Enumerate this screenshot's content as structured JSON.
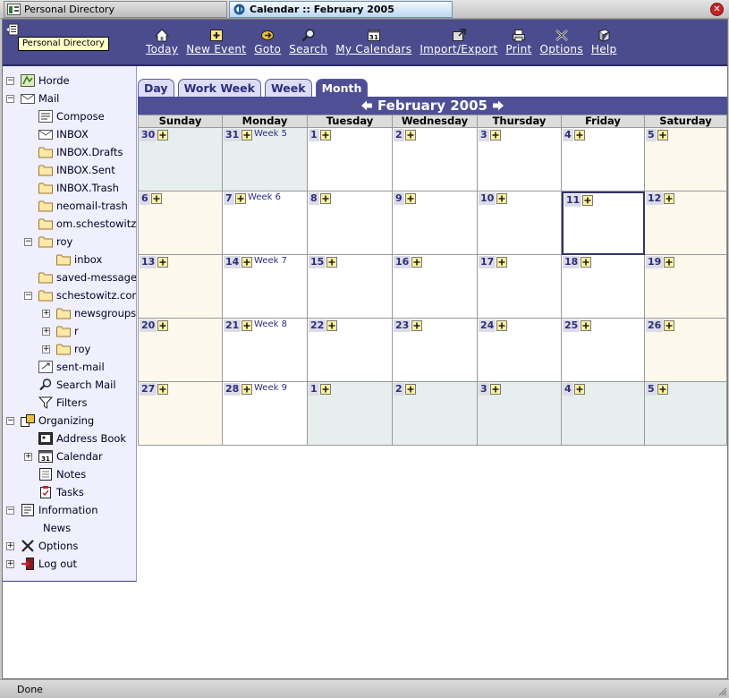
{
  "window_tabs": [
    {
      "label": "Personal Directory",
      "active": false
    },
    {
      "label": "Calendar :: February 2005",
      "active": true
    }
  ],
  "tooltip": "Personal Directory",
  "menu": [
    {
      "label": "Today",
      "icon": "home-icon"
    },
    {
      "label": "New Event",
      "icon": "new-event-icon"
    },
    {
      "label": "Goto",
      "icon": "goto-icon"
    },
    {
      "label": "Search",
      "icon": "search-icon"
    },
    {
      "label": "My Calendars",
      "icon": "calendar-icon"
    },
    {
      "label": "Import/Export",
      "icon": "import-export-icon"
    },
    {
      "label": "Print",
      "icon": "printer-icon"
    },
    {
      "label": "Options",
      "icon": "options-icon"
    },
    {
      "label": "Help",
      "icon": "help-icon"
    }
  ],
  "sidebar": {
    "items": [
      {
        "label": "Horde",
        "icon": "horde-icon"
      },
      {
        "label": "Mail",
        "icon": "mail-icon"
      },
      {
        "label": "Compose",
        "icon": "compose-icon"
      },
      {
        "label": "INBOX",
        "icon": "inbox-icon"
      },
      {
        "label": "INBOX.Drafts",
        "icon": "folder-icon"
      },
      {
        "label": "INBOX.Sent",
        "icon": "folder-icon"
      },
      {
        "label": "INBOX.Trash",
        "icon": "folder-icon"
      },
      {
        "label": "neomail-trash",
        "icon": "folder-icon"
      },
      {
        "label": "om.schestowitz",
        "icon": "folder-icon"
      },
      {
        "label": "roy",
        "icon": "folder-icon"
      },
      {
        "label": "inbox",
        "icon": "folder-icon"
      },
      {
        "label": "saved-messages",
        "icon": "folder-icon"
      },
      {
        "label": "schestowitz.com",
        "icon": "folder-icon"
      },
      {
        "label": "newsgroups",
        "icon": "folder-icon"
      },
      {
        "label": "r",
        "icon": "folder-icon"
      },
      {
        "label": "roy",
        "icon": "folder-icon"
      },
      {
        "label": "sent-mail",
        "icon": "sent-mail-icon"
      },
      {
        "label": "Search Mail",
        "icon": "search-icon"
      },
      {
        "label": "Filters",
        "icon": "filter-icon"
      },
      {
        "label": "Organizing",
        "icon": "organizing-icon"
      },
      {
        "label": "Address Book",
        "icon": "address-book-icon"
      },
      {
        "label": "Calendar",
        "icon": "calendar-icon"
      },
      {
        "label": "Notes",
        "icon": "notes-icon"
      },
      {
        "label": "Tasks",
        "icon": "tasks-icon"
      },
      {
        "label": "Information",
        "icon": "information-icon"
      },
      {
        "label": "News",
        "icon": ""
      },
      {
        "label": "Options",
        "icon": "options-icon"
      },
      {
        "label": "Log out",
        "icon": "logout-icon"
      }
    ]
  },
  "view_tabs": [
    {
      "label": "Day",
      "active": false
    },
    {
      "label": "Work Week",
      "active": false
    },
    {
      "label": "Week",
      "active": false
    },
    {
      "label": "Month",
      "active": true
    }
  ],
  "calendar": {
    "month_title": "February 2005",
    "day_headers": [
      "Sunday",
      "Monday",
      "Tuesday",
      "Wednesday",
      "Thursday",
      "Friday",
      "Saturday"
    ],
    "weeks": [
      {
        "week_label": "Week 5",
        "days": [
          "30",
          "31",
          "1",
          "2",
          "3",
          "4",
          "5"
        ]
      },
      {
        "week_label": "Week 6",
        "days": [
          "6",
          "7",
          "8",
          "9",
          "10",
          "11",
          "12"
        ]
      },
      {
        "week_label": "Week 7",
        "days": [
          "13",
          "14",
          "15",
          "16",
          "17",
          "18",
          "19"
        ]
      },
      {
        "week_label": "Week 8",
        "days": [
          "20",
          "21",
          "22",
          "23",
          "24",
          "25",
          "26"
        ]
      },
      {
        "week_label": "Week 9",
        "days": [
          "27",
          "28",
          "1",
          "2",
          "3",
          "4",
          "5"
        ]
      }
    ],
    "today": "11"
  },
  "status": "Done",
  "colors": {
    "menu_bg": "#4b4c8e",
    "sidebar_bg": "#efeffd",
    "weekend_bg": "#fcf8ec",
    "other_month_bg": "#e7eeee"
  }
}
